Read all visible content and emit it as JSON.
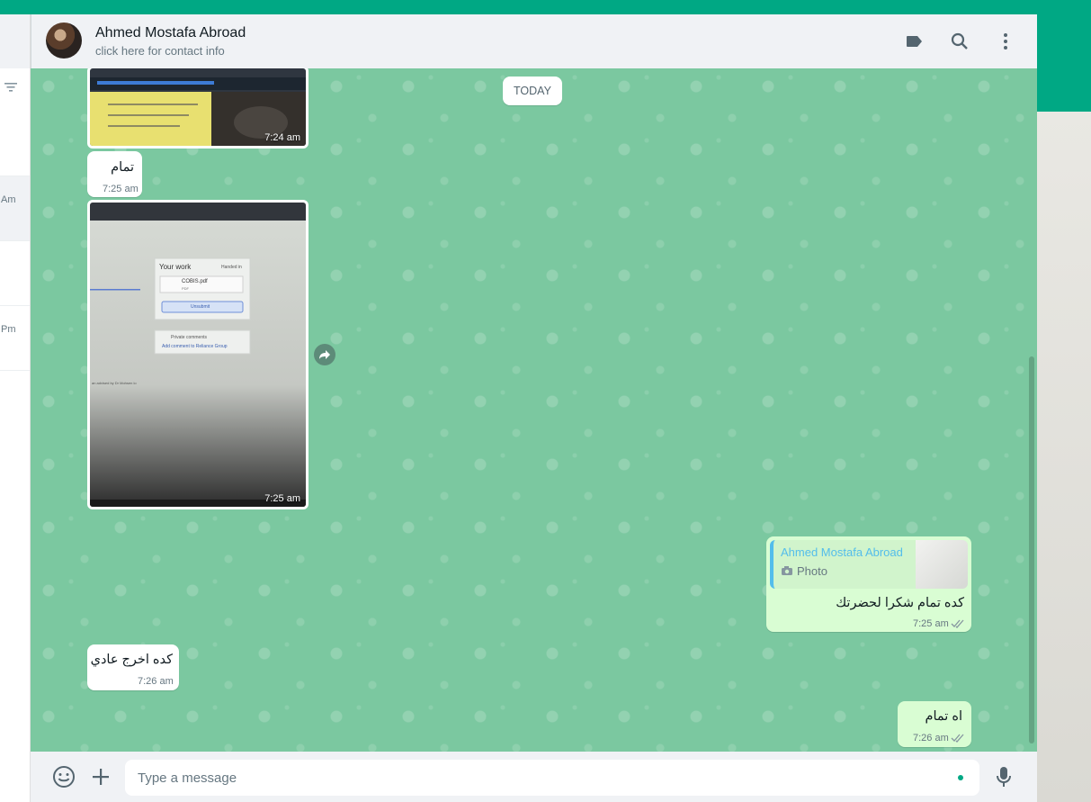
{
  "colors": {
    "accent": "#00a884",
    "chat_bg": "#7bc8a0",
    "outgoing_bubble": "#d9fdd3",
    "quote_name": "#53bdeb"
  },
  "sidebar": {
    "times": [
      "Am",
      "Pm"
    ],
    "icons": [
      "filter-icon"
    ]
  },
  "header": {
    "contact_name": "Ahmed Mostafa Abroad",
    "contact_subtitle": "click here for contact info",
    "icons": [
      "label-icon",
      "search-icon",
      "menu-dots-icon"
    ]
  },
  "chat": {
    "date_chip": "TODAY",
    "messages": [
      {
        "id": "img1",
        "direction": "in",
        "type": "image",
        "time": "7:24 am"
      },
      {
        "id": "txt1",
        "direction": "in",
        "type": "text",
        "text": "تمام",
        "time": "7:25 am"
      },
      {
        "id": "img2",
        "direction": "in",
        "type": "image",
        "time": "7:25 am",
        "image_text": {
          "heading": "Your work",
          "status": "Handed in",
          "file": "COBIS.pdf",
          "file_type": "PDF",
          "button": "Unsubmit",
          "comments": "Private comments",
          "add_comment": "Add comment to Reliance Group",
          "caption": "an advised by Dr Mohsen lo"
        }
      },
      {
        "id": "reply1",
        "direction": "out",
        "type": "reply",
        "quote_name": "Ahmed Mostafa Abroad",
        "quote_type": "Photo",
        "text": "كده  تمام شكرا لحضرتك",
        "time": "7:25 am",
        "status": "read"
      },
      {
        "id": "txt2",
        "direction": "in",
        "type": "text",
        "text": "كده اخرج عادي",
        "time": "7:26 am"
      },
      {
        "id": "txt3",
        "direction": "out",
        "type": "text",
        "text": "اه تمام",
        "time": "7:26 am",
        "status": "read"
      }
    ]
  },
  "composer": {
    "placeholder": "Type a message",
    "value": "",
    "icons": [
      "emoji-icon",
      "attach-plus-icon",
      "mic-icon"
    ]
  }
}
